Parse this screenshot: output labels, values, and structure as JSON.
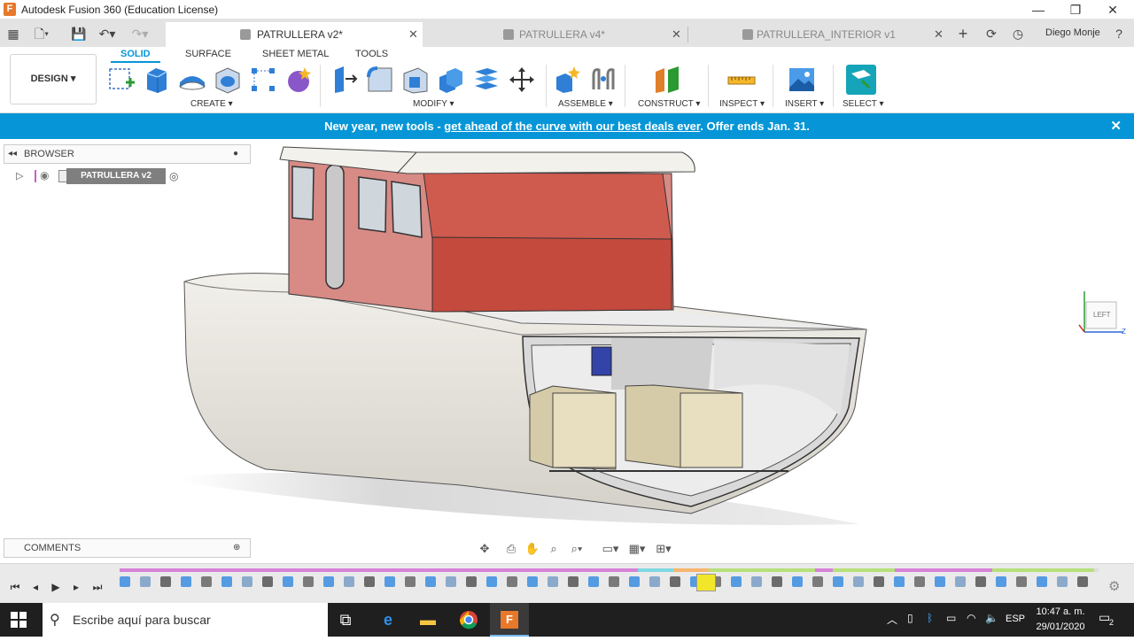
{
  "window": {
    "title": "Autodesk Fusion 360 (Education License)",
    "minimize": "—",
    "restore": "❐",
    "close": "✕"
  },
  "tabs": [
    {
      "label": "PATRULLERA v2*",
      "close": "✕"
    },
    {
      "label": "PATRULLERA v4*",
      "close": "✕"
    },
    {
      "label": "PATRULLERA_INTERIOR v1",
      "close": "✕"
    }
  ],
  "user": {
    "name": "Diego Monje"
  },
  "toolbar": {
    "workspace": "DESIGN ▾",
    "ribbon_tabs": [
      "SOLID",
      "SURFACE",
      "SHEET METAL",
      "TOOLS"
    ],
    "groups": [
      "CREATE ▾",
      "MODIFY ▾",
      "ASSEMBLE ▾",
      "CONSTRUCT ▾",
      "INSPECT ▾",
      "INSERT ▾",
      "SELECT ▾"
    ]
  },
  "banner": {
    "prefix": "New year, new tools - ",
    "link": "get ahead of the curve with our best deals ever",
    "suffix": ". Offer ends Jan. 31.",
    "close": "✕"
  },
  "browser": {
    "title": "BROWSER",
    "root_item": "PATRULLERA v2"
  },
  "comments": {
    "title": "COMMENTS"
  },
  "viewcube": {
    "face": "LEFT",
    "axis_z": "Z"
  },
  "taskbar": {
    "search_placeholder": "Escribe aquí para buscar",
    "language": "ESP",
    "time": "10:47 a. m.",
    "date": "29/01/2020",
    "notifications": "2"
  },
  "colors": {
    "accent": "#0696d7",
    "cabin": "#c9524a",
    "hull": "#ebe8e1",
    "crate": "#e6dbbe",
    "taskbar": "#1f1f1f"
  }
}
